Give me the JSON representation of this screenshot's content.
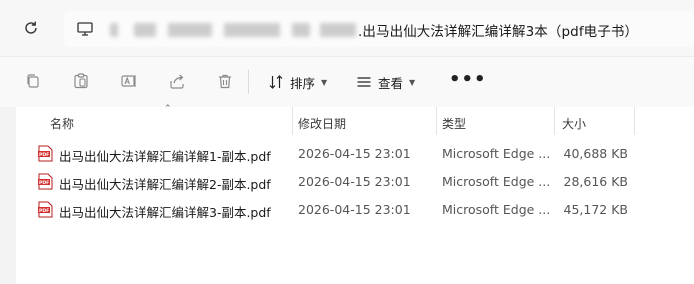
{
  "address_bar": {
    "path_visible_text": ".出马出仙大法详解汇编详解3本（pdf电子书）"
  },
  "toolbar": {
    "sort_label": "排序",
    "view_label": "查看",
    "more_label": "•••"
  },
  "columns": {
    "name": "名称",
    "modified": "修改日期",
    "type": "类型",
    "size": "大小"
  },
  "files": [
    {
      "name": "出马出仙大法详解汇编详解1-副本.pdf",
      "modified": "2026-04-15 23:01",
      "type": "Microsoft Edge ...",
      "size": "40,688 KB"
    },
    {
      "name": "出马出仙大法详解汇编详解2-副本.pdf",
      "modified": "2026-04-15 23:01",
      "type": "Microsoft Edge ...",
      "size": "28,616 KB"
    },
    {
      "name": "出马出仙大法详解汇编详解3-副本.pdf",
      "modified": "2026-04-15 23:01",
      "type": "Microsoft Edge ...",
      "size": "45,172 KB"
    }
  ],
  "colors": {
    "pdf_icon_red": "#d32f2f",
    "accent": "#1a1a1a"
  }
}
